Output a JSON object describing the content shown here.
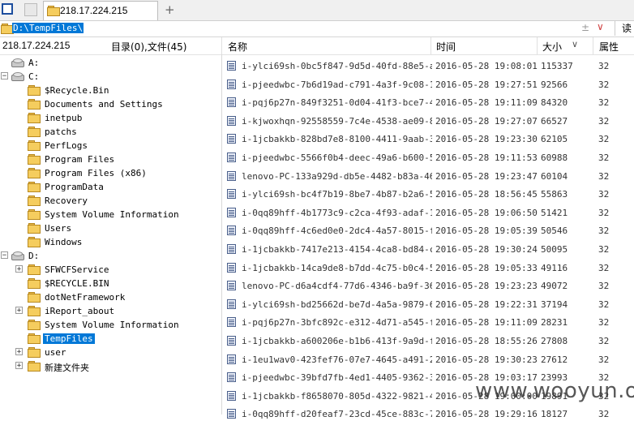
{
  "tabs": [
    {
      "label": "218.17.224.215"
    }
  ],
  "address": {
    "path": "D:\\TempFiles\\",
    "read_button": "读"
  },
  "status": {
    "host": "218.17.224.215",
    "summary": "目录(0),文件(45)"
  },
  "columns": {
    "name": "名称",
    "time": "时间",
    "size": "大小",
    "attr": "属性"
  },
  "tree": [
    {
      "label": "A:",
      "type": "drive",
      "level": 0,
      "expander": ""
    },
    {
      "label": "C:",
      "type": "drive",
      "level": 0,
      "expander": "−"
    },
    {
      "label": "$Recycle.Bin",
      "type": "folder",
      "level": 1,
      "expander": ""
    },
    {
      "label": "Documents and Settings",
      "type": "folder",
      "level": 1,
      "expander": ""
    },
    {
      "label": "inetpub",
      "type": "folder",
      "level": 1,
      "expander": ""
    },
    {
      "label": "patchs",
      "type": "folder",
      "level": 1,
      "expander": ""
    },
    {
      "label": "PerfLogs",
      "type": "folder",
      "level": 1,
      "expander": ""
    },
    {
      "label": "Program Files",
      "type": "folder",
      "level": 1,
      "expander": ""
    },
    {
      "label": "Program Files (x86)",
      "type": "folder",
      "level": 1,
      "expander": ""
    },
    {
      "label": "ProgramData",
      "type": "folder",
      "level": 1,
      "expander": ""
    },
    {
      "label": "Recovery",
      "type": "folder",
      "level": 1,
      "expander": ""
    },
    {
      "label": "System Volume Information",
      "type": "folder",
      "level": 1,
      "expander": ""
    },
    {
      "label": "Users",
      "type": "folder",
      "level": 1,
      "expander": ""
    },
    {
      "label": "Windows",
      "type": "folder",
      "level": 1,
      "expander": ""
    },
    {
      "label": "D:",
      "type": "drive",
      "level": 0,
      "expander": "−"
    },
    {
      "label": "SFWCFService",
      "type": "folder",
      "level": 1,
      "expander": "+"
    },
    {
      "label": "$RECYCLE.BIN",
      "type": "folder",
      "level": 1,
      "expander": ""
    },
    {
      "label": "dotNetFramework",
      "type": "folder",
      "level": 1,
      "expander": ""
    },
    {
      "label": "iReport_about",
      "type": "folder",
      "level": 1,
      "expander": "+"
    },
    {
      "label": "System Volume Information",
      "type": "folder",
      "level": 1,
      "expander": ""
    },
    {
      "label": "TempFiles",
      "type": "folder",
      "level": 1,
      "expander": "",
      "selected": true
    },
    {
      "label": "user",
      "type": "folder",
      "level": 1,
      "expander": "+"
    },
    {
      "label": "新建文件夹",
      "type": "folder",
      "level": 1,
      "expander": "+"
    }
  ],
  "files": [
    {
      "name": "i-ylci69sh-0bc5f847-9d5d-40fd-88e5-a...",
      "time": "2016-05-28 19:08:01",
      "size": "115337",
      "attr": "32"
    },
    {
      "name": "i-pjeedwbc-7b6d19ad-c791-4a3f-9c08-1...",
      "time": "2016-05-28 19:27:51",
      "size": "92566",
      "attr": "32"
    },
    {
      "name": "i-pqj6p27n-849f3251-0d04-41f3-bce7-4...",
      "time": "2016-05-28 19:11:09",
      "size": "84320",
      "attr": "32"
    },
    {
      "name": "i-kjwoxhqn-92558559-7c4e-4538-ae09-8...",
      "time": "2016-05-28 19:27:07",
      "size": "66527",
      "attr": "32"
    },
    {
      "name": "i-1jcbakkb-828bd7e8-8100-4411-9aab-3...",
      "time": "2016-05-28 19:23:30",
      "size": "62105",
      "attr": "32"
    },
    {
      "name": "i-pjeedwbc-5566f0b4-deec-49a6-b600-5...",
      "time": "2016-05-28 19:11:53",
      "size": "60988",
      "attr": "32"
    },
    {
      "name": "lenovo-PC-133a929d-db5e-4482-b83a-46...",
      "time": "2016-05-28 19:23:47",
      "size": "60104",
      "attr": "32"
    },
    {
      "name": "i-ylci69sh-bc4f7b19-8be7-4b87-b2a6-5...",
      "time": "2016-05-28 18:56:45",
      "size": "55863",
      "attr": "32"
    },
    {
      "name": "i-0qq89hff-4b1773c9-c2ca-4f93-adaf-1...",
      "time": "2016-05-28 19:06:50",
      "size": "51421",
      "attr": "32"
    },
    {
      "name": "i-0qq89hff-4c6ed0e0-2dc4-4a57-8015-f...",
      "time": "2016-05-28 19:05:39",
      "size": "50546",
      "attr": "32"
    },
    {
      "name": "i-1jcbakkb-7417e213-4154-4ca8-bd84-c...",
      "time": "2016-05-28 19:30:24",
      "size": "50095",
      "attr": "32"
    },
    {
      "name": "i-1jcbakkb-14ca9de8-b7dd-4c75-b0c4-5...",
      "time": "2016-05-28 19:05:33",
      "size": "49116",
      "attr": "32"
    },
    {
      "name": "lenovo-PC-d6a4cdf4-77d6-4346-ba9f-36...",
      "time": "2016-05-28 19:23:23",
      "size": "49072",
      "attr": "32"
    },
    {
      "name": "i-ylci69sh-bd25662d-be7d-4a5a-9879-6...",
      "time": "2016-05-28 19:22:31",
      "size": "37194",
      "attr": "32"
    },
    {
      "name": "i-pqj6p27n-3bfc892c-e312-4d71-a545-f...",
      "time": "2016-05-28 19:11:09",
      "size": "28231",
      "attr": "32"
    },
    {
      "name": "i-1jcbakkb-a600206e-b1b6-413f-9a9d-f...",
      "time": "2016-05-28 18:55:26",
      "size": "27808",
      "attr": "32"
    },
    {
      "name": "i-1eu1wav0-423fef76-07e7-4645-a491-2...",
      "time": "2016-05-28 19:30:23",
      "size": "27612",
      "attr": "32"
    },
    {
      "name": "i-pjeedwbc-39bfd7fb-4ed1-4405-9362-3...",
      "time": "2016-05-28 19:03:17",
      "size": "23993",
      "attr": "32"
    },
    {
      "name": "i-1jcbakkb-f8658070-805d-4322-9821-4...",
      "time": "2016-05-28 19:00:00",
      "size": "19891",
      "attr": "32"
    },
    {
      "name": "i-0qq89hff-d20feaf7-23cd-45ce-883c-7...",
      "time": "2016-05-28 19:29:16",
      "size": "18127",
      "attr": "32"
    }
  ],
  "watermark": "www.wooyun.org",
  "colors": {
    "accent": "#0078d7",
    "folder": "#f5cd5e"
  }
}
